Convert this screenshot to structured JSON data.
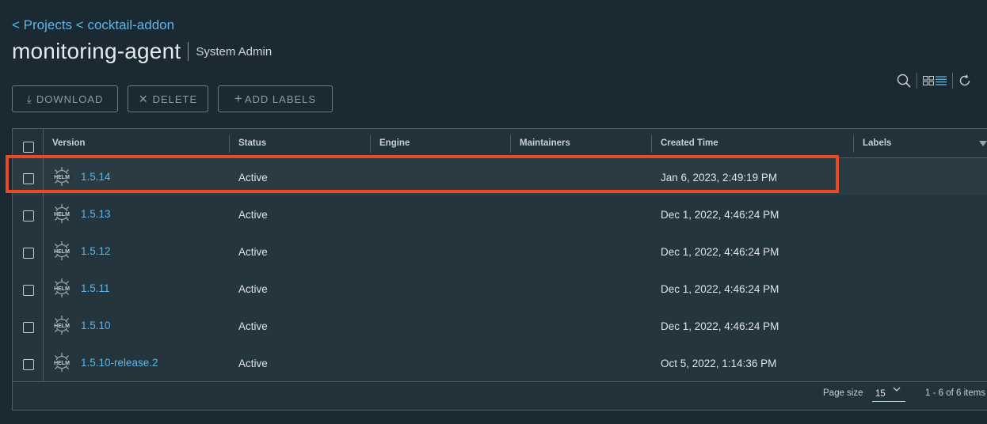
{
  "breadcrumb": {
    "projects": "< Projects",
    "project": "< cocktail-addon"
  },
  "page": {
    "title": "monitoring-agent",
    "role": "System Admin"
  },
  "toolbar": {
    "download": "DOWNLOAD",
    "delete": "DELETE",
    "add_labels": "ADD LABELS"
  },
  "icons": [
    "search-icon",
    "card-view-icon",
    "list-view-icon",
    "refresh-icon",
    "helm-icon",
    "filter-icon"
  ],
  "table": {
    "columns": [
      "Version",
      "Status",
      "Engine",
      "Maintainers",
      "Created Time",
      "Labels"
    ],
    "rows": [
      {
        "version": "1.5.14",
        "status": "Active",
        "engine": "",
        "maintainers": "",
        "created": "Jan 6, 2023, 2:49:19 PM",
        "labels": ""
      },
      {
        "version": "1.5.13",
        "status": "Active",
        "engine": "",
        "maintainers": "",
        "created": "Dec 1, 2022, 4:46:24 PM",
        "labels": ""
      },
      {
        "version": "1.5.12",
        "status": "Active",
        "engine": "",
        "maintainers": "",
        "created": "Dec 1, 2022, 4:46:24 PM",
        "labels": ""
      },
      {
        "version": "1.5.11",
        "status": "Active",
        "engine": "",
        "maintainers": "",
        "created": "Dec 1, 2022, 4:46:24 PM",
        "labels": ""
      },
      {
        "version": "1.5.10",
        "status": "Active",
        "engine": "",
        "maintainers": "",
        "created": "Dec 1, 2022, 4:46:24 PM",
        "labels": ""
      },
      {
        "version": "1.5.10-release.2",
        "status": "Active",
        "engine": "",
        "maintainers": "",
        "created": "Oct 5, 2022, 1:14:36 PM",
        "labels": ""
      }
    ]
  },
  "footer": {
    "page_size_label": "Page size",
    "page_size": "15",
    "range": "1 - 6 of 6 items"
  },
  "colors": {
    "background": "#1b2a32",
    "link": "#5eb5e6",
    "highlight": "#e84b24"
  }
}
